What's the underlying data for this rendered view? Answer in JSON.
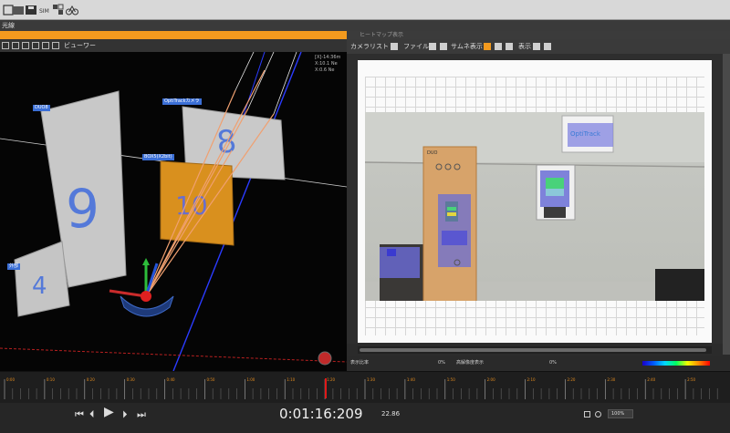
{
  "toolbar": {
    "icons": [
      "toolbar-icon-1",
      "toolbar-icon-2",
      "toolbar-icon-3",
      "toolbar-icon-4",
      "toolbar-icon-5",
      "toolbar-icon-6"
    ]
  },
  "tab": {
    "label": "光線"
  },
  "left_pane": {
    "toolbar_label": "ビューワー",
    "info_lines": [
      "[X]-14:36m",
      "X:10.1 Ne",
      "X:0.6 Ne"
    ],
    "labels": {
      "duo": "DUO8",
      "optitrack": "OptiTrackカメラ",
      "boxed_label": "BOX5(X2bit)",
      "small_box": "外部"
    },
    "panel_digits": {
      "p9": "9",
      "p8": "8",
      "p10": "10",
      "p4": "4"
    }
  },
  "right_pane": {
    "title": "ヒートマップ表示",
    "toolbar": {
      "item1": "カメラリスト",
      "item2": "ファイル",
      "item3": "サムネ表示",
      "item4": "表示"
    },
    "photo_labels": {
      "optitrack": "OptiTrack",
      "duo": "DUO"
    }
  },
  "status": {
    "left": "表示比率",
    "pct1": "0%",
    "mid_label": "高解像度表示",
    "pct2": "0%"
  },
  "timeline": {
    "labels": [
      "0:00",
      "0:10",
      "0:20",
      "0:30",
      "0:40",
      "0:50",
      "1:00",
      "1:10",
      "1:20",
      "1:30",
      "1:40",
      "1:50",
      "2:00",
      "2:10",
      "2:20",
      "2:30",
      "2:40",
      "2:50"
    ],
    "playhead_progress": 0.444
  },
  "transport": {
    "time": "0:01:16:209",
    "frames": "22.86",
    "zoom": "100%"
  },
  "colors": {
    "accent": "#f39a1e",
    "playhead": "#e11919",
    "panel": "#2b2b2b"
  }
}
